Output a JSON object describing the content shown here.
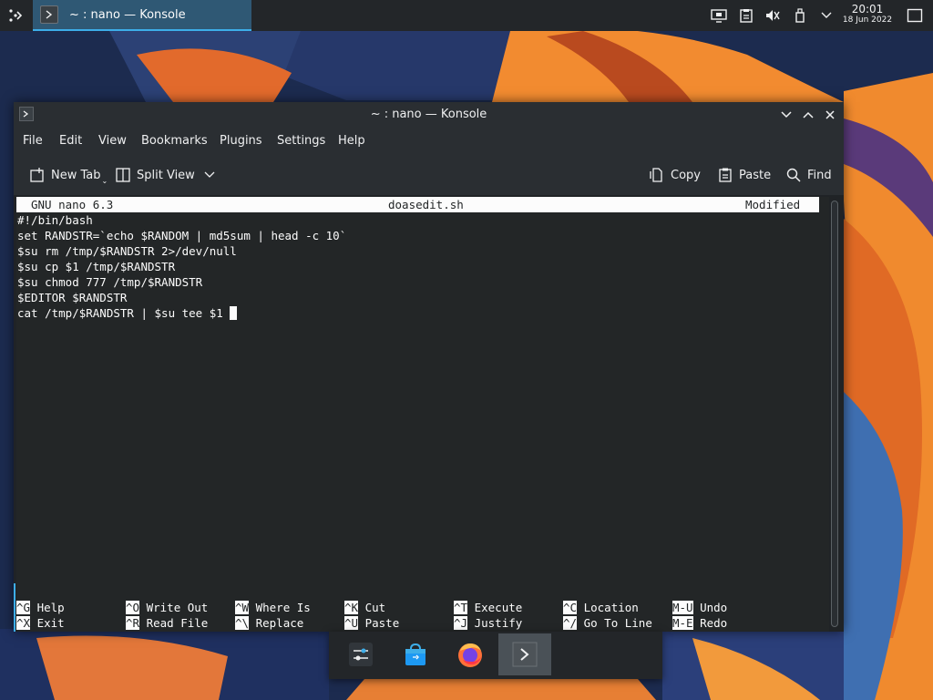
{
  "panel": {
    "task_title": "~ : nano — Konsole",
    "clock_time": "20:01",
    "clock_date": "18 Jun 2022"
  },
  "window": {
    "title": "~ : nano — Konsole",
    "menu": [
      "File",
      "Edit",
      "View",
      "Bookmarks",
      "Plugins",
      "Settings",
      "Help"
    ],
    "toolbar": {
      "new_tab": "New Tab",
      "split_view": "Split View",
      "copy": "Copy",
      "paste": "Paste",
      "find": "Find"
    }
  },
  "nano": {
    "version": "GNU nano 6.3",
    "filename": "doasedit.sh",
    "status": "Modified",
    "lines": [
      "#!/bin/bash",
      "set RANDSTR=`echo $RANDOM | md5sum | head -c 10`",
      "$su rm /tmp/$RANDSTR 2>/dev/null",
      "$su cp $1 /tmp/$RANDSTR",
      "$su chmod 777 /tmp/$RANDSTR",
      "$EDITOR $RANDSTR",
      "cat /tmp/$RANDSTR | $su tee $1 "
    ],
    "shortcuts_row1": [
      {
        "key": "^G",
        "label": "Help"
      },
      {
        "key": "^O",
        "label": "Write Out"
      },
      {
        "key": "^W",
        "label": "Where Is"
      },
      {
        "key": "^K",
        "label": "Cut"
      },
      {
        "key": "^T",
        "label": "Execute"
      },
      {
        "key": "^C",
        "label": "Location"
      },
      {
        "key": "M-U",
        "label": "Undo"
      }
    ],
    "shortcuts_row2": [
      {
        "key": "^X",
        "label": "Exit"
      },
      {
        "key": "^R",
        "label": "Read File"
      },
      {
        "key": "^\\",
        "label": "Replace"
      },
      {
        "key": "^U",
        "label": "Paste"
      },
      {
        "key": "^J",
        "label": "Justify"
      },
      {
        "key": "^/",
        "label": "Go To Line"
      },
      {
        "key": "M-E",
        "label": "Redo"
      }
    ]
  },
  "colors": {
    "accent": "#3daee9",
    "panel_bg": "#232629",
    "terminal_bg": "#232627",
    "terminal_fg": "#fcfcfc"
  },
  "dock": {
    "items": [
      "settings-icon",
      "discover-store-icon",
      "firefox-icon",
      "konsole-icon"
    ]
  }
}
